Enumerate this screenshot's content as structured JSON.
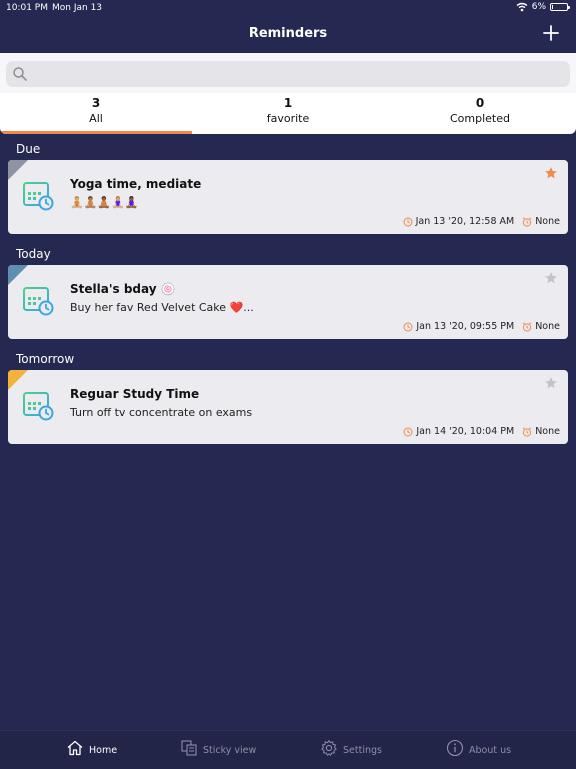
{
  "status": {
    "time": "10:01 PM",
    "date": "Mon Jan 13",
    "battery": "6%",
    "battery_level": 0.06
  },
  "nav": {
    "title": "Reminders",
    "add_icon": "plus-icon"
  },
  "search": {
    "placeholder": "",
    "value": ""
  },
  "tabs": [
    {
      "count": "3",
      "label": "All",
      "active": true
    },
    {
      "count": "1",
      "label": "favorite",
      "active": false
    },
    {
      "count": "0",
      "label": "Completed",
      "active": false
    }
  ],
  "sections": [
    {
      "label": "Due",
      "reminder": {
        "title": "Yoga time, mediate",
        "subtitle": "🧘🏼🧘🏽🧘🏾🧘🏼‍♀️🧘🏾‍♀️",
        "datetime": "Jan 13 '20, 12:58 AM",
        "repeat": "None",
        "favorite": true,
        "accent": "#8f93a4"
      }
    },
    {
      "label": "Today",
      "reminder": {
        "title": "Stella's bday 🍥",
        "subtitle": "Buy her fav Red Velvet Cake ❤️...",
        "datetime": "Jan 13 '20, 09:55 PM",
        "repeat": "None",
        "favorite": false,
        "accent": "#5f8fb0"
      }
    },
    {
      "label": "Tomorrow",
      "reminder": {
        "title": "Reguar Study Time",
        "subtitle": "Turn off tv concentrate on exams",
        "datetime": "Jan 14 '20, 10:04 PM",
        "repeat": "None",
        "favorite": false,
        "accent": "#f5b13d"
      }
    }
  ],
  "tabbar": {
    "home": "Home",
    "sticky": "Sticky view",
    "settings": "Settings",
    "about": "About us"
  },
  "colors": {
    "background": "#252850",
    "accent_orange": "#ef8a4c",
    "favorite_star": "#ef8a4c",
    "unfavorite_star": "#c3c3c8",
    "calendar_green": "#4dcf8a",
    "calendar_blue": "#3aa6e0"
  }
}
